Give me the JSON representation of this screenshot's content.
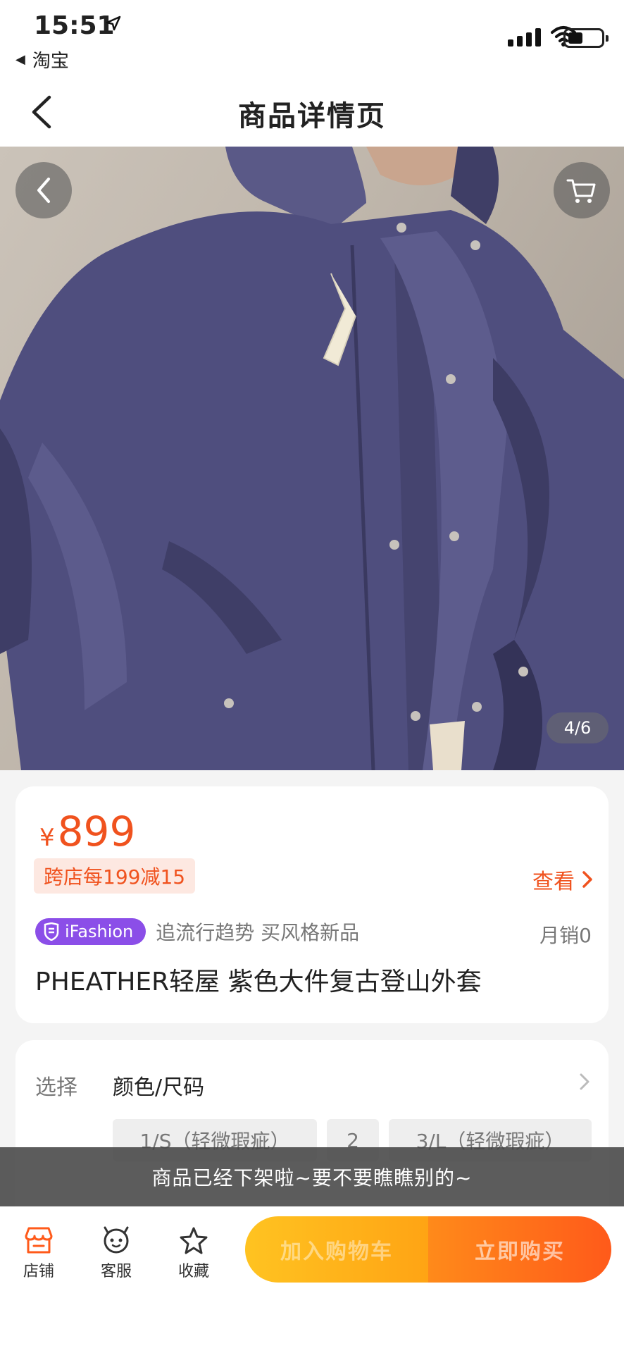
{
  "status_bar": {
    "time": "15:51",
    "back_app": "淘宝"
  },
  "nav": {
    "title": "商品详情页"
  },
  "gallery": {
    "counter": "4/6"
  },
  "price_card": {
    "currency": "¥",
    "price": "899",
    "coupon": "跨店每199减15",
    "view_more": "查看",
    "brand_tag": "iFashion",
    "slogan": "追流行趋势 买风格新品",
    "monthly_sales": "月销0",
    "product_title": "PHEATHER轻屋 紫色大件复古登山外套"
  },
  "options": {
    "label": "选择",
    "value": "颜色/尺码",
    "chips": [
      "1/S（轻微瑕疵）",
      "2",
      "3/L（轻微瑕疵）"
    ]
  },
  "toast": "商品已经下架啦~要不要瞧瞧别的~",
  "bottom_bar": {
    "store": "店铺",
    "service": "客服",
    "favorite": "收藏",
    "add_to_cart": "加入购物车",
    "buy_now": "立即购买"
  },
  "colors": {
    "accent": "#f0521e",
    "brand_tag": "#8b4ee8",
    "cart_button": "#ffb31a",
    "buy_button": "#ff6a1a"
  }
}
